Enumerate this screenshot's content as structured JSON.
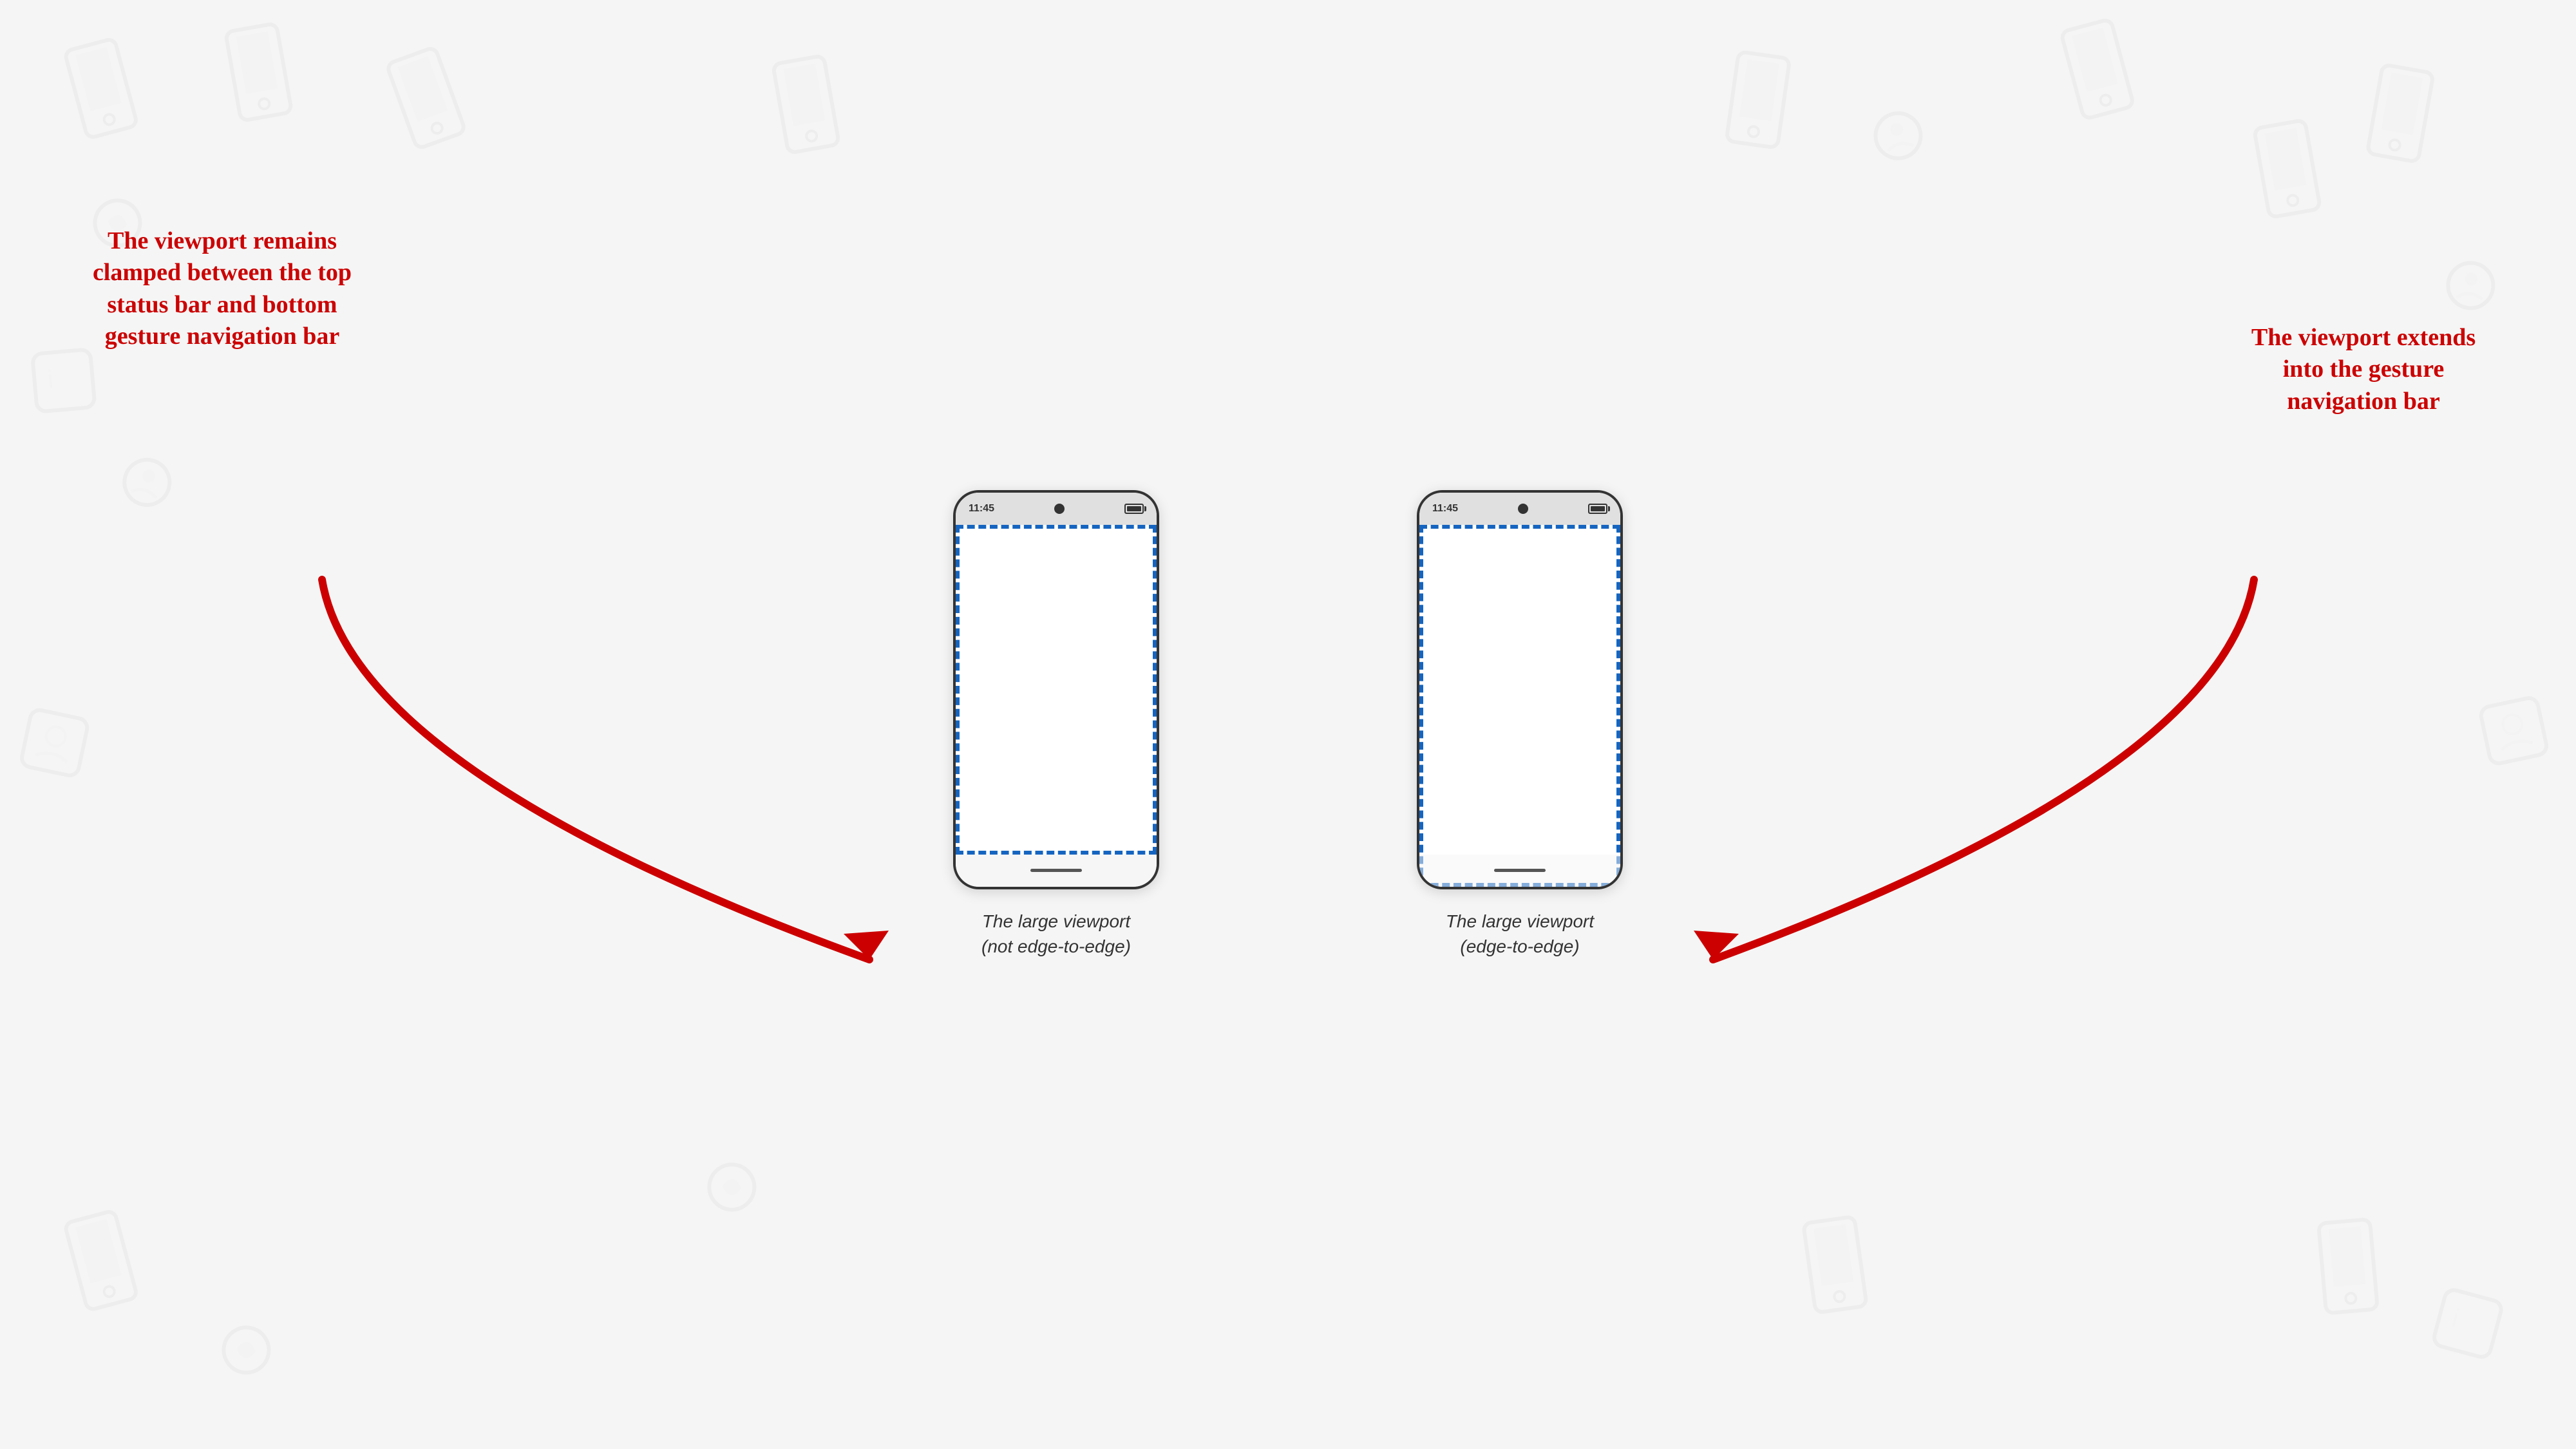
{
  "background_color": "#f5f5f5",
  "phones": [
    {
      "id": "not-edge-to-edge",
      "status_time": "11:45",
      "caption_line1": "The large viewport",
      "caption_line2": "(not edge-to-edge)",
      "viewport_type": "clamped"
    },
    {
      "id": "edge-to-edge",
      "status_time": "11:45",
      "caption_line1": "The large viewport",
      "caption_line2": "(edge-to-edge)",
      "viewport_type": "edge"
    }
  ],
  "annotation_left": {
    "text": "The viewport remains clamped between the top status bar and bottom gesture navigation bar"
  },
  "annotation_right": {
    "text": "The viewport extends into the gesture navigation bar"
  },
  "arrow_left": "points from left annotation to bottom of left phone",
  "arrow_right": "points from right annotation to bottom of right phone"
}
